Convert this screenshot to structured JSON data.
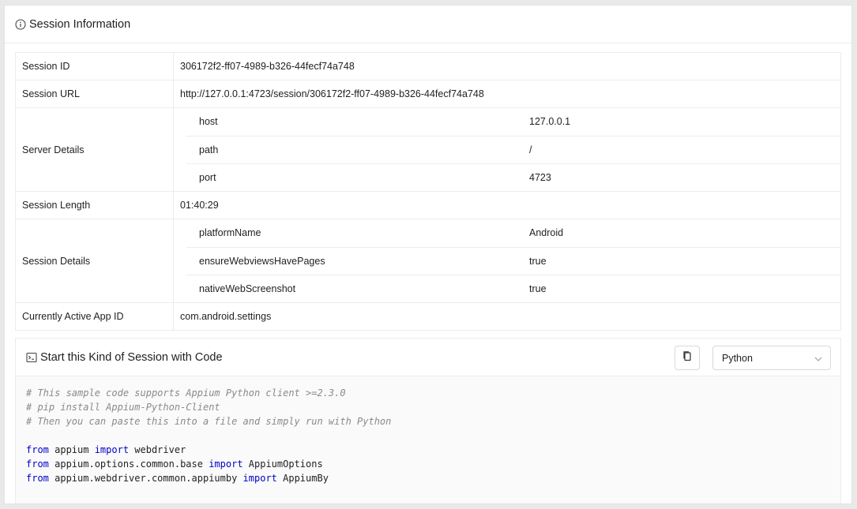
{
  "header": {
    "title": "Session Information",
    "icon": "info-icon"
  },
  "rows": [
    {
      "label": "Session ID",
      "value": "306172f2-ff07-4989-b326-44fecf74a748"
    },
    {
      "label": "Session URL",
      "value": "http://127.0.0.1:4723/session/306172f2-ff07-4989-b326-44fecf74a748"
    },
    {
      "label": "Server Details",
      "sub": [
        {
          "key": "host",
          "value": "127.0.0.1"
        },
        {
          "key": "path",
          "value": "/"
        },
        {
          "key": "port",
          "value": "4723"
        }
      ]
    },
    {
      "label": "Session Length",
      "value": "01:40:29"
    },
    {
      "label": "Session Details",
      "sub": [
        {
          "key": "platformName",
          "value": "Android"
        },
        {
          "key": "ensureWebviewsHavePages",
          "value": "true"
        },
        {
          "key": "nativeWebScreenshot",
          "value": "true"
        }
      ]
    },
    {
      "label": "Currently Active App ID",
      "value": "com.android.settings"
    }
  ],
  "code_card": {
    "title": "Start this Kind of Session with Code",
    "icon": "terminal-icon",
    "copy_icon": "copy-icon",
    "language": "Python",
    "comment_lines": [
      "# This sample code supports Appium Python client >=2.3.0",
      "# pip install Appium-Python-Client",
      "# Then you can paste this into a file and simply run with Python"
    ],
    "import_lines": [
      {
        "from_kw": "from",
        "module": " appium ",
        "import_kw": "import",
        "name": " webdriver"
      },
      {
        "from_kw": "from",
        "module": " appium.options.common.base ",
        "import_kw": "import",
        "name": " AppiumOptions"
      },
      {
        "from_kw": "from",
        "module": " appium.webdriver.common.appiumby ",
        "import_kw": "import",
        "name": " AppiumBy"
      }
    ]
  }
}
